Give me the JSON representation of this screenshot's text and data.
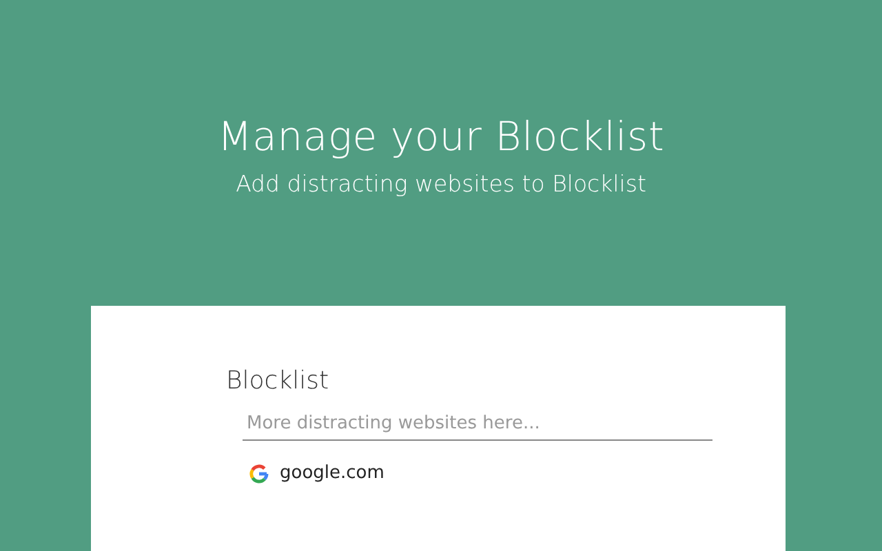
{
  "header": {
    "title": "Manage your Blocklist",
    "subtitle": "Add distracting websites to Blocklist"
  },
  "card": {
    "heading": "Blocklist",
    "input": {
      "placeholder": "More distracting websites here..."
    },
    "sites": [
      {
        "domain": "google.com"
      }
    ]
  }
}
